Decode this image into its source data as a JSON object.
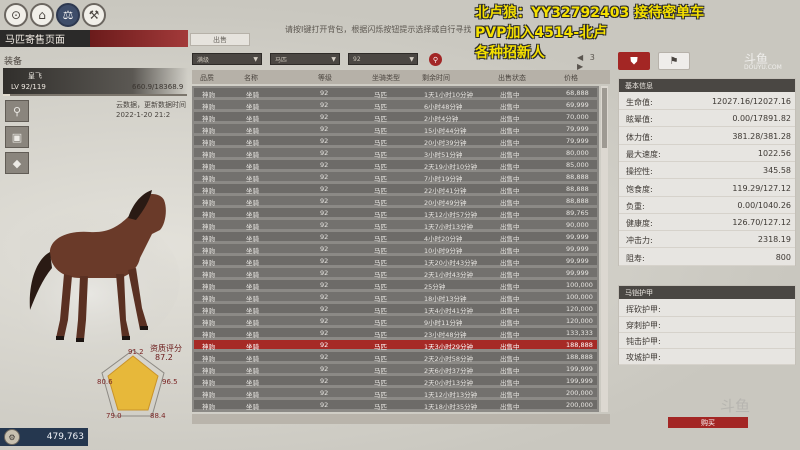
{
  "window": {
    "title": "马匹寄售页面",
    "sell_tab": "出售",
    "hint": "请按I键打开背包，根据闪烁按钮提示选择或自行寻找"
  },
  "topbar": {
    "icons": [
      "horse-feed-icon",
      "stable-icon",
      "market-icon",
      "tools-icon"
    ]
  },
  "horse": {
    "equip_label": "装备",
    "name": "皇飞",
    "level": "LV 92/119",
    "xp": "660.9/18368.9",
    "xp_fraction": 0.036,
    "cloud_note": "云数据，更新数据时间",
    "cloud_date": "2022-1-20 21:2",
    "rating_label": "资质评分",
    "rating_value": "87.2",
    "pentagon": {
      "top": "91.2",
      "left": "80.6",
      "right": "96.5",
      "bottom_left": "79.0",
      "bottom_right": "88.4"
    }
  },
  "money": {
    "amount": "479,763"
  },
  "filters": {
    "box1": "满级",
    "box2": "马匹",
    "box3": "92",
    "page_current": "3"
  },
  "table": {
    "headers": [
      "品质",
      "名称",
      "等级",
      "坐骑类型",
      "剩余时间",
      "出售状态",
      "价格"
    ],
    "rows": [
      {
        "quality": "神驹",
        "name": "坐骑",
        "level": "92",
        "type": "马匹",
        "time": "1天1小时10分钟",
        "status": "出售中",
        "price": "68,888"
      },
      {
        "quality": "神驹",
        "name": "坐骑",
        "level": "92",
        "type": "马匹",
        "time": "6小时48分钟",
        "status": "出售中",
        "price": "69,999"
      },
      {
        "quality": "神驹",
        "name": "坐骑",
        "level": "92",
        "type": "马匹",
        "time": "2小时4分钟",
        "status": "出售中",
        "price": "70,000"
      },
      {
        "quality": "神驹",
        "name": "坐骑",
        "level": "92",
        "type": "马匹",
        "time": "15小时44分钟",
        "status": "出售中",
        "price": "79,999"
      },
      {
        "quality": "神驹",
        "name": "坐骑",
        "level": "92",
        "type": "马匹",
        "time": "20小时39分钟",
        "status": "出售中",
        "price": "79,999"
      },
      {
        "quality": "神驹",
        "name": "坐骑",
        "level": "92",
        "type": "马匹",
        "time": "3小时51分钟",
        "status": "出售中",
        "price": "80,000"
      },
      {
        "quality": "神驹",
        "name": "坐骑",
        "level": "92",
        "type": "马匹",
        "time": "2天19小时10分钟",
        "status": "出售中",
        "price": "85,000"
      },
      {
        "quality": "神驹",
        "name": "坐骑",
        "level": "92",
        "type": "马匹",
        "time": "7小时19分钟",
        "status": "出售中",
        "price": "88,888"
      },
      {
        "quality": "神驹",
        "name": "坐骑",
        "level": "92",
        "type": "马匹",
        "time": "22小时41分钟",
        "status": "出售中",
        "price": "88,888"
      },
      {
        "quality": "神驹",
        "name": "坐骑",
        "level": "92",
        "type": "马匹",
        "time": "20小时49分钟",
        "status": "出售中",
        "price": "88,888"
      },
      {
        "quality": "神驹",
        "name": "坐骑",
        "level": "92",
        "type": "马匹",
        "time": "1天12小时57分钟",
        "status": "出售中",
        "price": "89,765"
      },
      {
        "quality": "神驹",
        "name": "坐骑",
        "level": "92",
        "type": "马匹",
        "time": "1天7小时13分钟",
        "status": "出售中",
        "price": "90,000"
      },
      {
        "quality": "神驹",
        "name": "坐骑",
        "level": "92",
        "type": "马匹",
        "time": "4小时20分钟",
        "status": "出售中",
        "price": "99,999"
      },
      {
        "quality": "神驹",
        "name": "坐骑",
        "level": "92",
        "type": "马匹",
        "time": "10小时9分钟",
        "status": "出售中",
        "price": "99,999"
      },
      {
        "quality": "神驹",
        "name": "坐骑",
        "level": "92",
        "type": "马匹",
        "time": "1天20小时43分钟",
        "status": "出售中",
        "price": "99,999"
      },
      {
        "quality": "神驹",
        "name": "坐骑",
        "level": "92",
        "type": "马匹",
        "time": "2天1小时43分钟",
        "status": "出售中",
        "price": "99,999"
      },
      {
        "quality": "神驹",
        "name": "坐骑",
        "level": "92",
        "type": "马匹",
        "time": "25分钟",
        "status": "出售中",
        "price": "100,000"
      },
      {
        "quality": "神驹",
        "name": "坐骑",
        "level": "92",
        "type": "马匹",
        "time": "18小时13分钟",
        "status": "出售中",
        "price": "100,000"
      },
      {
        "quality": "神驹",
        "name": "坐骑",
        "level": "92",
        "type": "马匹",
        "time": "1天4小时41分钟",
        "status": "出售中",
        "price": "120,000"
      },
      {
        "quality": "神驹",
        "name": "坐骑",
        "level": "92",
        "type": "马匹",
        "time": "9小时11分钟",
        "status": "出售中",
        "price": "120,000"
      },
      {
        "quality": "神驹",
        "name": "坐骑",
        "level": "92",
        "type": "马匹",
        "time": "23小时48分钟",
        "status": "出售中",
        "price": "133,333"
      },
      {
        "quality": "神驹",
        "name": "坐骑",
        "level": "92",
        "type": "马匹",
        "time": "1天3小时29分钟",
        "status": "出售中",
        "price": "188,888",
        "selected": true
      },
      {
        "quality": "神驹",
        "name": "坐骑",
        "level": "92",
        "type": "马匹",
        "time": "2天2小时58分钟",
        "status": "出售中",
        "price": "188,888"
      },
      {
        "quality": "神驹",
        "name": "坐骑",
        "level": "92",
        "type": "马匹",
        "time": "2天6小时37分钟",
        "status": "出售中",
        "price": "199,999"
      },
      {
        "quality": "神驹",
        "name": "坐骑",
        "level": "92",
        "type": "马匹",
        "time": "2天0小时13分钟",
        "status": "出售中",
        "price": "199,999"
      },
      {
        "quality": "神驹",
        "name": "坐骑",
        "level": "92",
        "type": "马匹",
        "time": "1天12小时13分钟",
        "status": "出售中",
        "price": "200,000"
      },
      {
        "quality": "神驹",
        "name": "坐骑",
        "level": "92",
        "type": "马匹",
        "time": "1天18小时35分钟",
        "status": "出售中",
        "price": "200,000"
      }
    ]
  },
  "stats": {
    "title": "基本信息",
    "rows": [
      {
        "label": "生命值:",
        "value": "12027.16/12027.16"
      },
      {
        "label": "眩晕值:",
        "value": "0.00/17891.82"
      },
      {
        "label": "体力值:",
        "value": "381.28/381.28"
      },
      {
        "label": "最大速度:",
        "value": "1022.56"
      },
      {
        "label": "操控性:",
        "value": "345.58"
      },
      {
        "label": "饱食度:",
        "value": "119.29/127.12"
      },
      {
        "label": "负重:",
        "value": "0.00/1040.26"
      },
      {
        "label": "健康度:",
        "value": "126.70/127.12"
      },
      {
        "label": "冲击力:",
        "value": "2318.19"
      },
      {
        "label": "阻寿:",
        "value": "800"
      }
    ]
  },
  "armor": {
    "title": "马铠护甲",
    "rows": [
      "挥砍护甲:",
      "穿刺护甲:",
      "钝击护甲:",
      "攻城护甲:"
    ]
  },
  "buy_label": "购买",
  "overlay": {
    "line1": "北卢狼：YY32792403 接待密单车",
    "line2": "PVP加入4514-北卢",
    "line3": "各种招新人"
  },
  "watermark": {
    "brand": "斗鱼",
    "url": "DOUYU.COM"
  },
  "colors": {
    "accent_red": "#a32624",
    "dark_panel": "#2b2a29",
    "overlay_yellow": "#f5e000"
  }
}
